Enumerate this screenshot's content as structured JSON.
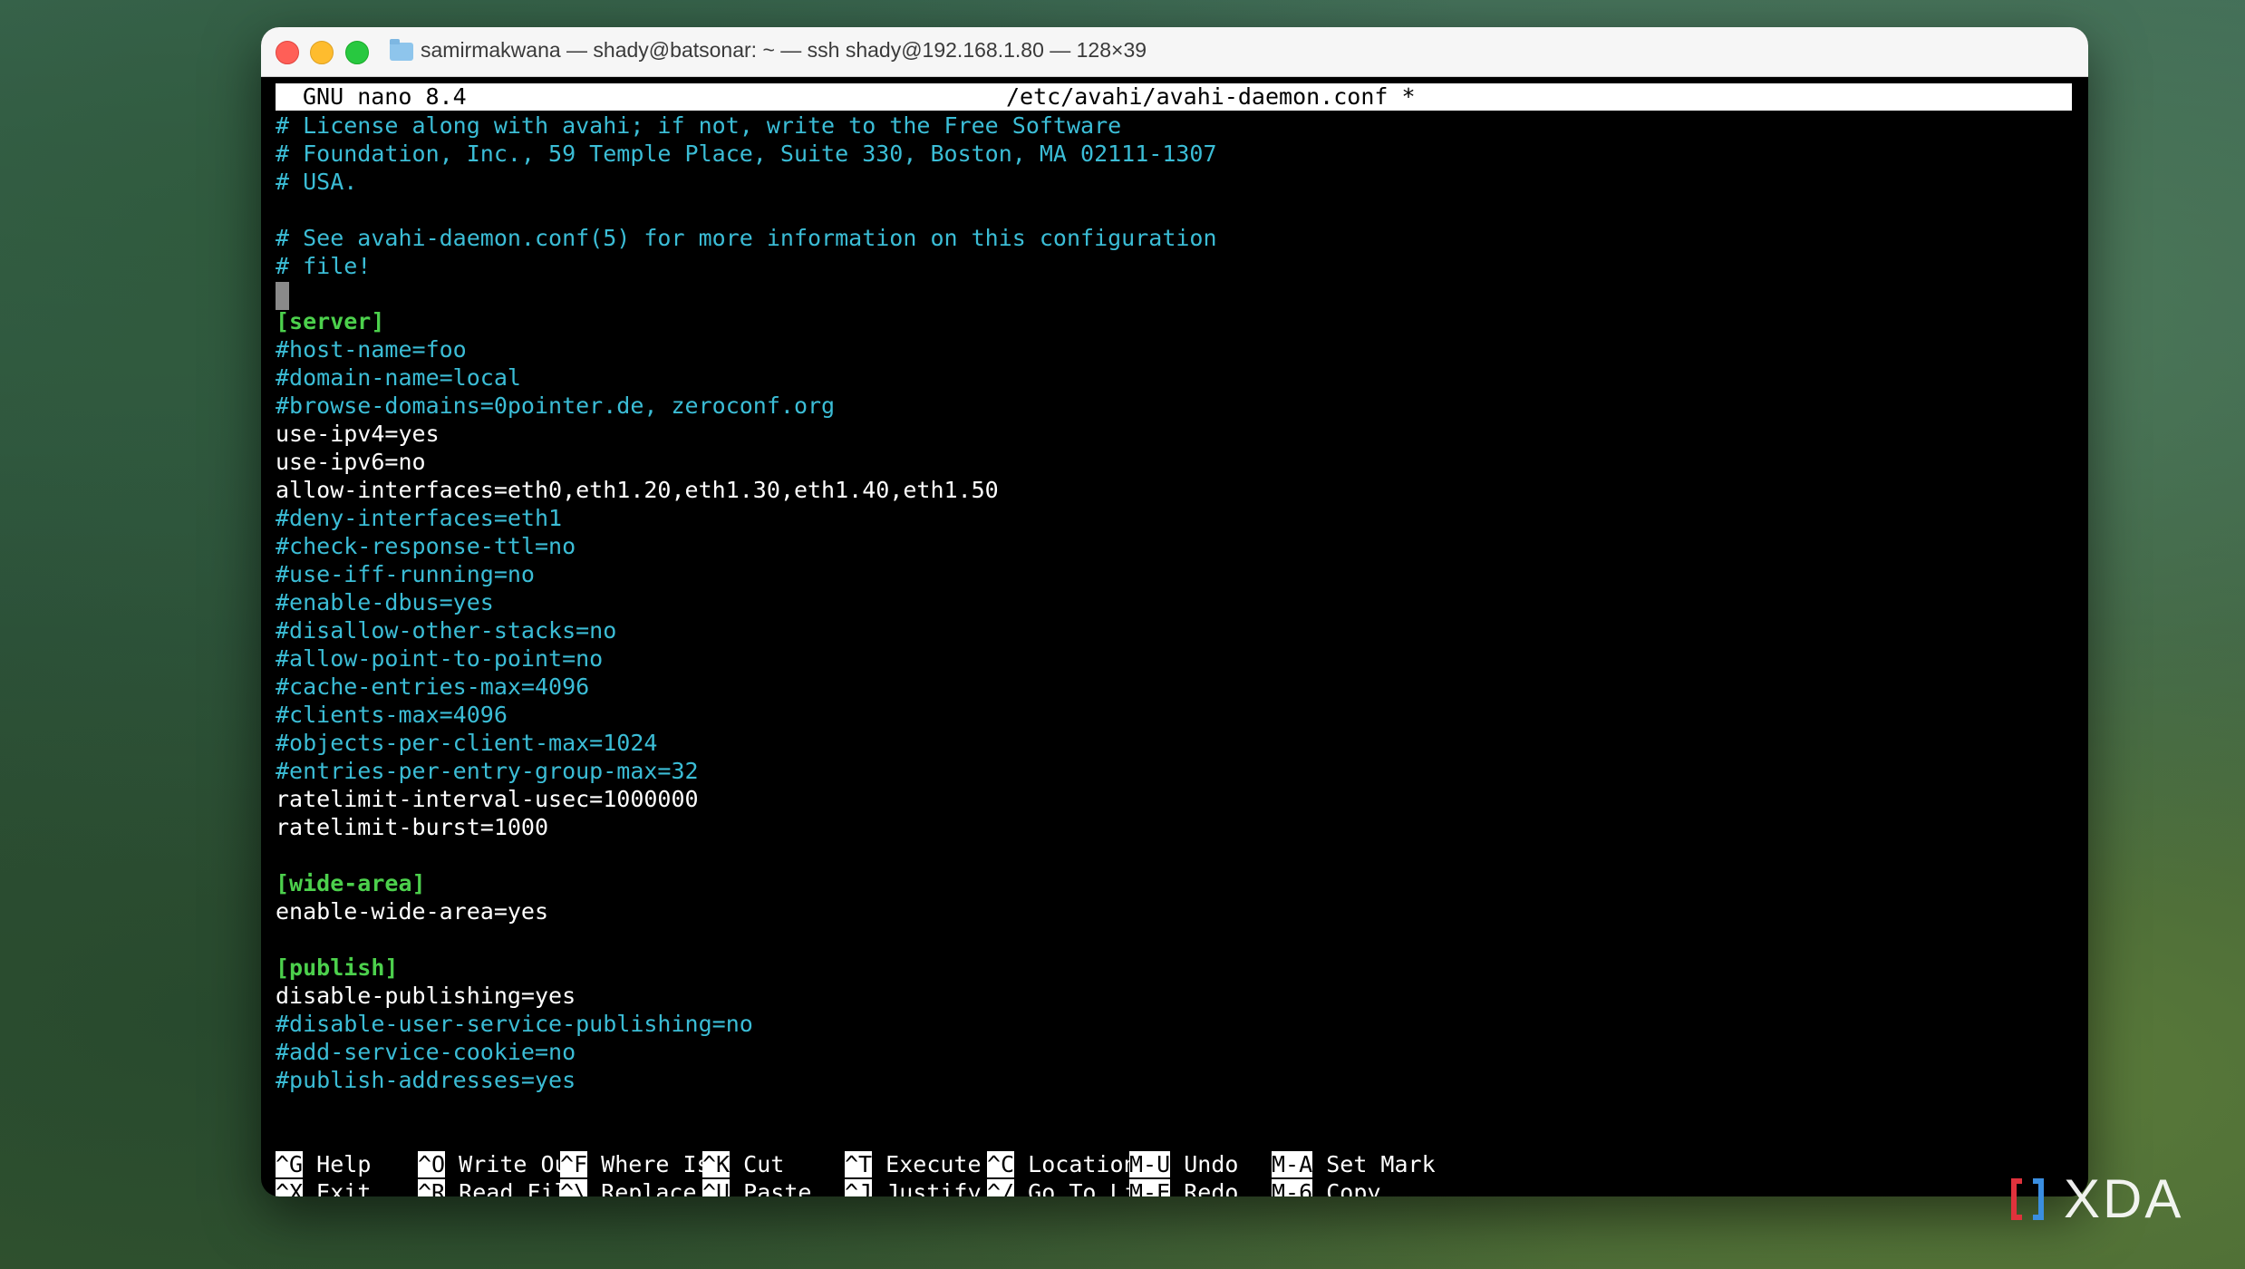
{
  "window": {
    "title": "samirmakwana — shady@batsonar: ~ — ssh shady@192.168.1.80 — 128×39"
  },
  "nano": {
    "version": "GNU nano 8.4",
    "filename": "/etc/avahi/avahi-daemon.conf *"
  },
  "lines": [
    {
      "type": "comment",
      "text": "# License along with avahi; if not, write to the Free Software"
    },
    {
      "type": "comment",
      "text": "# Foundation, Inc., 59 Temple Place, Suite 330, Boston, MA 02111-1307"
    },
    {
      "type": "comment",
      "text": "# USA."
    },
    {
      "type": "blank",
      "text": ""
    },
    {
      "type": "comment",
      "text": "# See avahi-daemon.conf(5) for more information on this configuration"
    },
    {
      "type": "comment",
      "text": "# file!"
    },
    {
      "type": "cursor",
      "text": ""
    },
    {
      "type": "section",
      "text": "[server]"
    },
    {
      "type": "comment",
      "text": "#host-name=foo"
    },
    {
      "type": "comment",
      "text": "#domain-name=local"
    },
    {
      "type": "comment",
      "text": "#browse-domains=0pointer.de, zeroconf.org"
    },
    {
      "type": "setting",
      "text": "use-ipv4=yes"
    },
    {
      "type": "setting",
      "text": "use-ipv6=no"
    },
    {
      "type": "setting",
      "text": "allow-interfaces=eth0,eth1.20,eth1.30,eth1.40,eth1.50"
    },
    {
      "type": "comment",
      "text": "#deny-interfaces=eth1"
    },
    {
      "type": "comment",
      "text": "#check-response-ttl=no"
    },
    {
      "type": "comment",
      "text": "#use-iff-running=no"
    },
    {
      "type": "comment",
      "text": "#enable-dbus=yes"
    },
    {
      "type": "comment",
      "text": "#disallow-other-stacks=no"
    },
    {
      "type": "comment",
      "text": "#allow-point-to-point=no"
    },
    {
      "type": "comment",
      "text": "#cache-entries-max=4096"
    },
    {
      "type": "comment",
      "text": "#clients-max=4096"
    },
    {
      "type": "comment",
      "text": "#objects-per-client-max=1024"
    },
    {
      "type": "comment",
      "text": "#entries-per-entry-group-max=32"
    },
    {
      "type": "setting",
      "text": "ratelimit-interval-usec=1000000"
    },
    {
      "type": "setting",
      "text": "ratelimit-burst=1000"
    },
    {
      "type": "blank",
      "text": ""
    },
    {
      "type": "section",
      "text": "[wide-area]"
    },
    {
      "type": "setting",
      "text": "enable-wide-area=yes"
    },
    {
      "type": "blank",
      "text": ""
    },
    {
      "type": "section",
      "text": "[publish]"
    },
    {
      "type": "setting",
      "text": "disable-publishing=yes"
    },
    {
      "type": "comment",
      "text": "#disable-user-service-publishing=no"
    },
    {
      "type": "comment",
      "text": "#add-service-cookie=no"
    },
    {
      "type": "comment",
      "text": "#publish-addresses=yes"
    }
  ],
  "shortcuts": [
    [
      {
        "key": "^G",
        "label": "Help"
      },
      {
        "key": "^O",
        "label": "Write Out"
      },
      {
        "key": "^F",
        "label": "Where Is"
      },
      {
        "key": "^K",
        "label": "Cut"
      },
      {
        "key": "^T",
        "label": "Execute"
      },
      {
        "key": "^C",
        "label": "Location"
      },
      {
        "key": "M-U",
        "label": "Undo"
      },
      {
        "key": "M-A",
        "label": "Set Mark"
      }
    ],
    [
      {
        "key": "^X",
        "label": "Exit"
      },
      {
        "key": "^R",
        "label": "Read File"
      },
      {
        "key": "^\\",
        "label": "Replace"
      },
      {
        "key": "^U",
        "label": "Paste"
      },
      {
        "key": "^J",
        "label": "Justify"
      },
      {
        "key": "^/",
        "label": "Go To Line"
      },
      {
        "key": "M-E",
        "label": "Redo"
      },
      {
        "key": "M-6",
        "label": "Copy"
      }
    ]
  ],
  "watermark": {
    "text": "XDA",
    "colors": {
      "mark_red": "#e0323c",
      "mark_blue": "#3a8ee0"
    }
  }
}
